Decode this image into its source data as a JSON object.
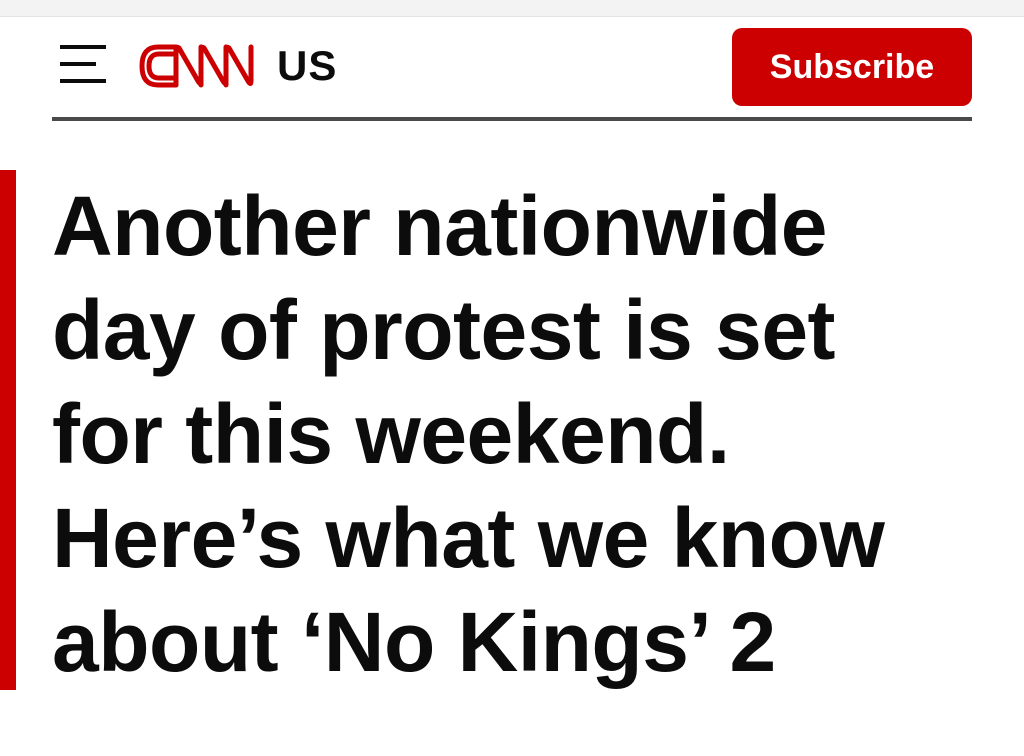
{
  "header": {
    "menu_icon": "hamburger-menu-icon",
    "logo": {
      "text": "CNN",
      "color": "#cc0000"
    },
    "section": "US",
    "subscribe_label": "Subscribe"
  },
  "article": {
    "headline_lines": [
      "Another nationwide",
      "day of protest is set",
      "for this weekend.",
      "Here’s what we know",
      "about ‘No Kings’ 2"
    ]
  },
  "colors": {
    "brand_red": "#cc0000",
    "text": "#0c0c0c",
    "divider": "#4a4a4a",
    "background": "#ffffff"
  }
}
